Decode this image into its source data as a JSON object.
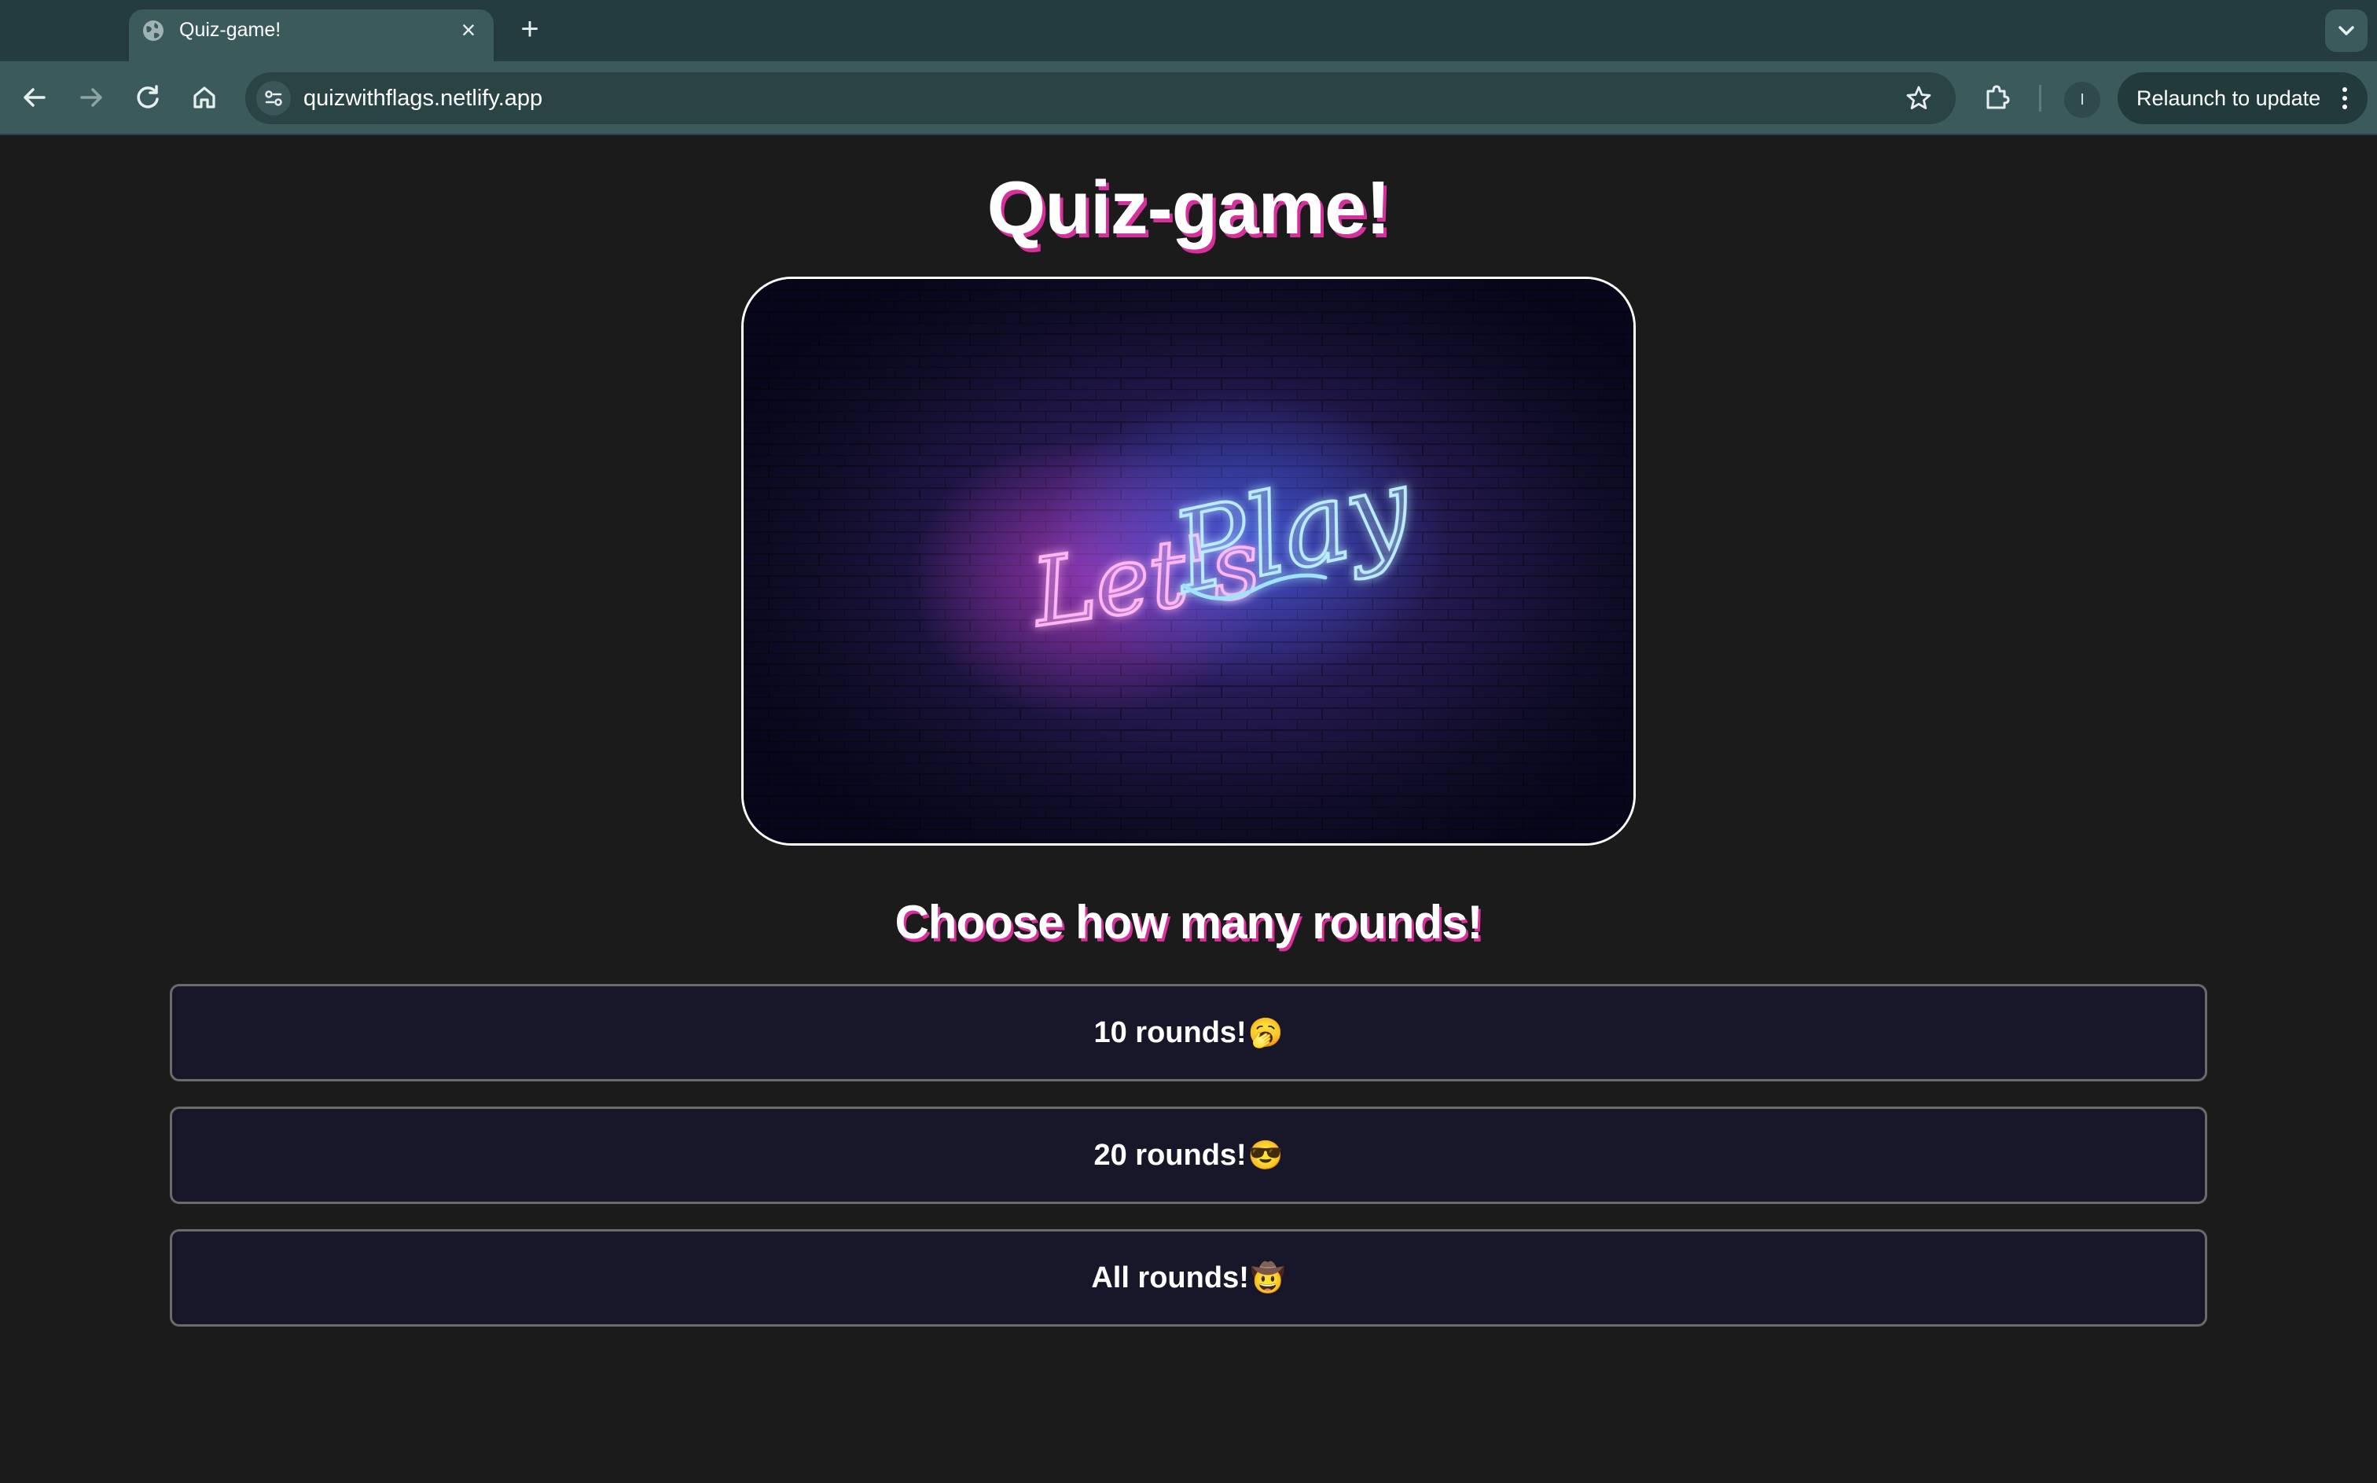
{
  "browser": {
    "tab": {
      "title": "Quiz-game!",
      "close_glyph": "×",
      "favicon": "globe-icon"
    },
    "new_tab_glyph": "+",
    "url": "quizwithflags.netlify.app",
    "profile_initial": "I",
    "relaunch_label": "Relaunch to update"
  },
  "page": {
    "title": "Quiz-game!",
    "hero": {
      "neon_text_pink": "Let's",
      "neon_text_blue": "Play"
    },
    "subtitle": "Choose how many rounds!",
    "rounds": [
      {
        "label": "10 rounds!",
        "emoji": "🥱"
      },
      {
        "label": "20 rounds!",
        "emoji": "😎"
      },
      {
        "label": "All rounds!",
        "emoji": "🤠"
      }
    ]
  },
  "colors": {
    "chrome_dark": "#243c40",
    "chrome_light": "#3a5a5c",
    "page_bg": "#1b1b1b",
    "title_shadow": "#d72f9b",
    "button_bg": "#18172a",
    "neon_pink": "#ff5ce0",
    "neon_blue": "#5ad2ff"
  }
}
